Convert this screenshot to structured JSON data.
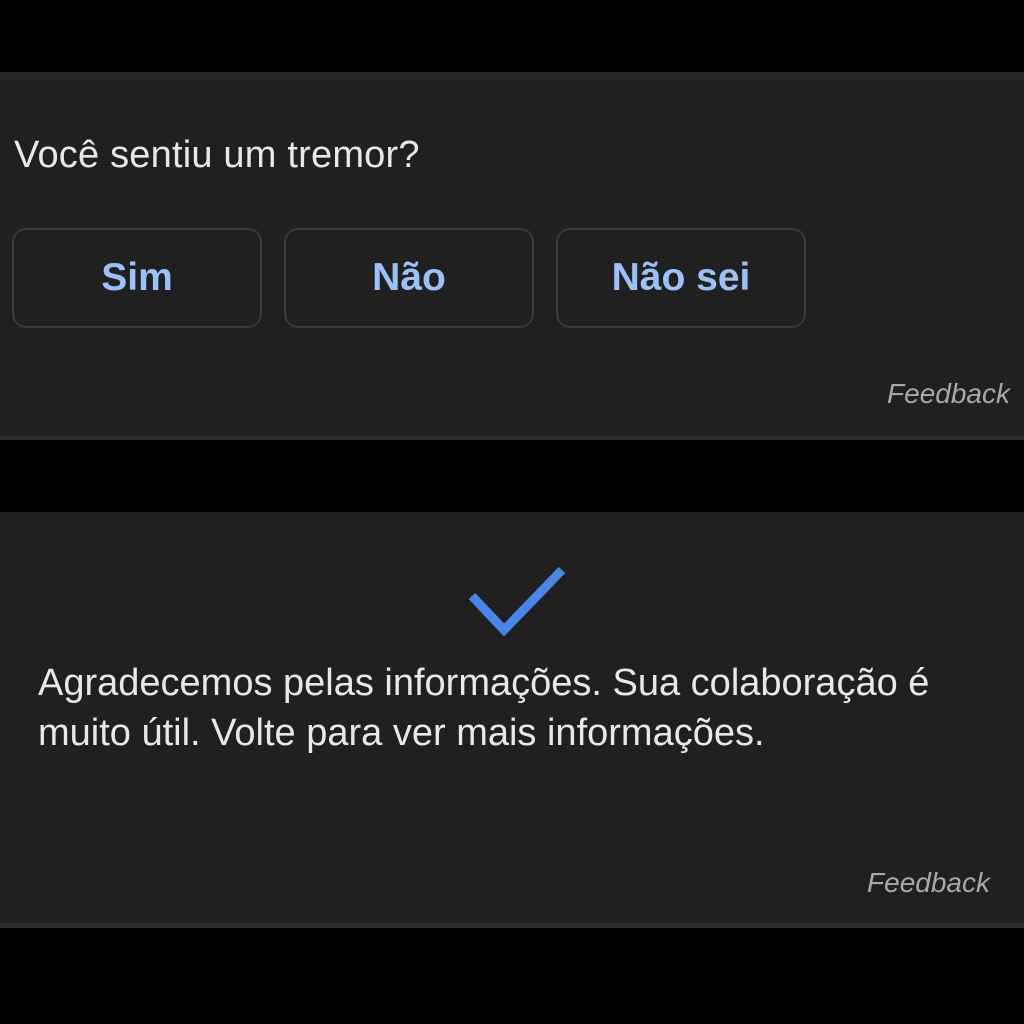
{
  "question_card": {
    "question": "Você sentiu um tremor?",
    "options": [
      {
        "label": "Sim"
      },
      {
        "label": "Não"
      },
      {
        "label": "Não sei"
      }
    ],
    "feedback_label": "Feedback"
  },
  "confirmation_card": {
    "icon": "checkmark-icon",
    "message": "Agradecemos pelas informações. Sua colaboração é muito útil. Volte para ver mais informações.",
    "feedback_label": "Feedback"
  },
  "colors": {
    "background": "#000000",
    "card": "#202020",
    "accent_text": "#9dc0f6",
    "check": "#4a86e8",
    "body_text": "#e8e8e8",
    "muted_text": "#a8a8a8"
  }
}
